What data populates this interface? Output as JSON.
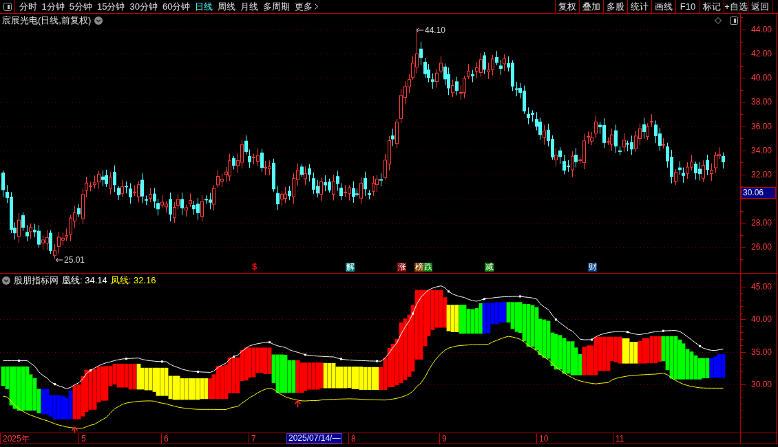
{
  "toolbar": {
    "periods": [
      {
        "label": "分时",
        "selected": false
      },
      {
        "label": "1分钟",
        "selected": false
      },
      {
        "label": "5分钟",
        "selected": false
      },
      {
        "label": "15分钟",
        "selected": false
      },
      {
        "label": "30分钟",
        "selected": false
      },
      {
        "label": "60分钟",
        "selected": false
      },
      {
        "label": "日线",
        "selected": true
      },
      {
        "label": "周线",
        "selected": false
      },
      {
        "label": "月线",
        "selected": false
      },
      {
        "label": "多周期",
        "selected": false
      }
    ],
    "more": "更多",
    "actions": [
      "复权",
      "叠加",
      "多股",
      "统计",
      "画线",
      "F10",
      "标记",
      "+自选",
      "返回"
    ]
  },
  "price_chart": {
    "title": "宸展光电(日线,前复权)",
    "high_marker": "44.10",
    "low_marker": "25.01",
    "events": [
      {
        "kind": "text",
        "label": "$",
        "color": "#ff0000"
      },
      {
        "kind": "tag",
        "label": "解",
        "color": "#008080"
      },
      {
        "kind": "tag",
        "label": "涨",
        "color": "#800000"
      },
      {
        "kind": "tag",
        "label": "榜",
        "color": "#804000"
      },
      {
        "kind": "tag",
        "label": "跌",
        "color": "#008000"
      },
      {
        "kind": "tag",
        "label": "减",
        "color": "#008000"
      },
      {
        "kind": "tag",
        "label": "财",
        "color": "#003c80"
      }
    ],
    "axis_labels": [
      "44.00",
      "42.00",
      "40.00",
      "38.00",
      "36.00",
      "34.00",
      "32.00",
      "28.00",
      "26.00"
    ],
    "current_price": "30.06"
  },
  "indicator": {
    "name": "股朋指标网",
    "lines": [
      {
        "text": "凰线: 34.14",
        "color": "#ffffff"
      },
      {
        "text": "凤线: 32.16",
        "color": "#ffff00"
      }
    ],
    "axis_labels": [
      "45.00",
      "40.00",
      "35.00",
      "30.00"
    ]
  },
  "time_axis": {
    "labels": [
      "2025年",
      "5",
      "6",
      "7",
      "8",
      "9",
      "10",
      "11"
    ],
    "cursor_date": "2025/07/14/—"
  }
}
